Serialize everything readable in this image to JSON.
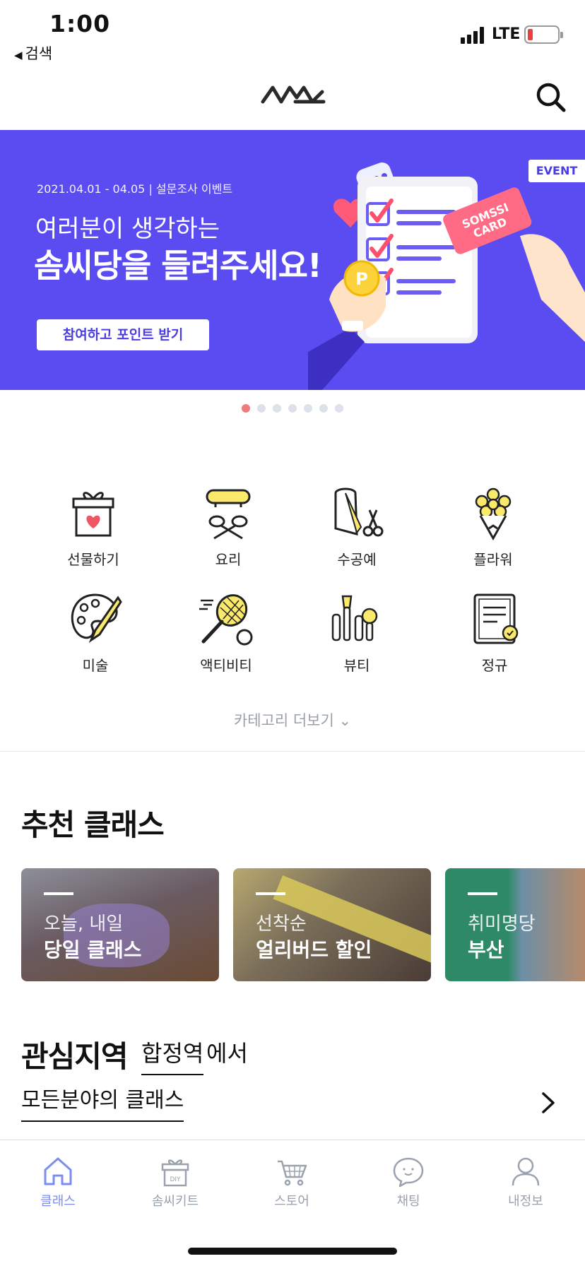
{
  "status_bar": {
    "time": "1:00",
    "back_label": "검색",
    "network": "LTE",
    "battery_color": "#e8413a"
  },
  "header": {
    "logo_icon": "somssi-logo-icon",
    "search_icon": "search-icon"
  },
  "banner": {
    "date": "2021.04.01 - 04.05 | 설문조사 이벤트",
    "subtitle": "여러분이 생각하는",
    "title": "솜씨당을 들려주세요!",
    "button": "참여하고 포인트 받기",
    "tag": "EVENT",
    "card_text_1": "SOMSSI",
    "card_text_2": "CARD",
    "coin_text": "P",
    "background": "#5b4cf2"
  },
  "carousel": {
    "count": 7,
    "active_index": 0
  },
  "categories": [
    {
      "label": "선물하기",
      "icon": "gift-icon"
    },
    {
      "label": "요리",
      "icon": "cooking-icon"
    },
    {
      "label": "수공예",
      "icon": "craft-icon"
    },
    {
      "label": "플라워",
      "icon": "flower-icon"
    },
    {
      "label": "미술",
      "icon": "palette-icon"
    },
    {
      "label": "액티비티",
      "icon": "tennis-icon"
    },
    {
      "label": "뷰티",
      "icon": "beauty-icon"
    },
    {
      "label": "정규",
      "icon": "certificate-icon"
    }
  ],
  "more_categories": "카테고리 더보기",
  "recommended": {
    "title": "추천 클래스",
    "cards": [
      {
        "line1": "오늘, 내일",
        "line2": "당일 클래스"
      },
      {
        "line1": "선착순",
        "line2": "얼리버드 할인"
      },
      {
        "line1": "취미명당",
        "line2": "부산"
      }
    ]
  },
  "region": {
    "title": "관심지역",
    "place": "합정역",
    "suffix": "에서",
    "field": "모든분야의 클래스"
  },
  "tabbar": {
    "items": [
      {
        "label": "클래스",
        "icon": "home-icon",
        "active": true
      },
      {
        "label": "솜씨키트",
        "icon": "diy-kit-icon",
        "active": false
      },
      {
        "label": "스토어",
        "icon": "cart-icon",
        "active": false
      },
      {
        "label": "채팅",
        "icon": "chat-icon",
        "active": false
      },
      {
        "label": "내정보",
        "icon": "profile-icon",
        "active": false
      }
    ],
    "diy_text": "DIY"
  },
  "colors": {
    "accent": "#5b4cf2",
    "yellow": "#fbe96b",
    "active_dot": "#f07b7b",
    "tab_active": "#7b8ef0"
  }
}
